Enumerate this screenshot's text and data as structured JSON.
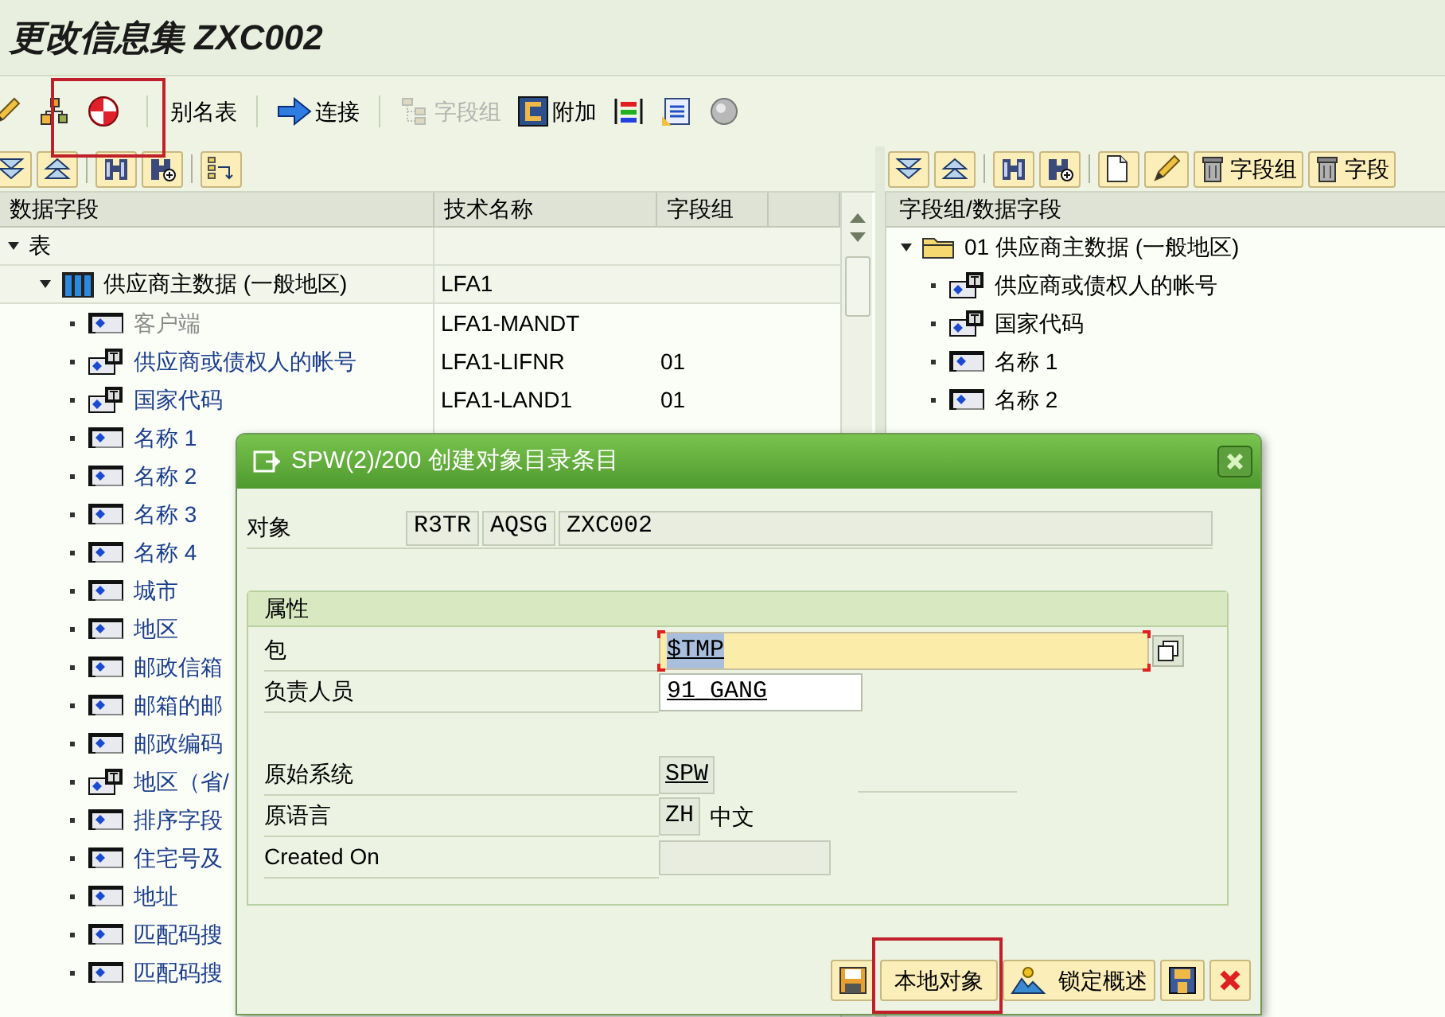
{
  "window": {
    "title": "更改信息集 ZXC002"
  },
  "toolbar": [
    {
      "kind": "icon"
    },
    {
      "kind": "icon"
    },
    {
      "kind": "icon",
      "highlighted": true
    },
    {
      "kind": "separator"
    },
    {
      "kind": "text",
      "label": "别名表",
      "disabled": false
    },
    {
      "kind": "separator"
    },
    {
      "kind": "icon-text",
      "label": "连接",
      "disabled": false
    },
    {
      "kind": "separator"
    },
    {
      "kind": "icon-text",
      "label": "字段组",
      "disabled": true
    },
    {
      "kind": "icon-text",
      "label": "附加",
      "disabled": false
    },
    {
      "kind": "icon"
    },
    {
      "kind": "icon"
    },
    {
      "kind": "icon"
    }
  ],
  "left_pane": {
    "columns": [
      "数据字段",
      "技术名称",
      "字段组"
    ],
    "tree": [
      {
        "label": "表",
        "expanded": true,
        "children": [
          {
            "label": "供应商主数据 (一般地区)",
            "technical_name": "LFA1",
            "kind": "table",
            "expanded": true,
            "children": [
              {
                "label": "客户端",
                "kind": "field",
                "disabled": true,
                "technical_name": "LFA1-MANDT"
              },
              {
                "label": "供应商或债权人的帐号",
                "kind": "text-field",
                "disabled": false,
                "technical_name": "LFA1-LIFNR",
                "field_group": "01"
              },
              {
                "label": "国家代码",
                "kind": "text-field",
                "disabled": false,
                "technical_name": "LFA1-LAND1",
                "field_group": "01"
              },
              {
                "label": "名称 1",
                "kind": "field",
                "disabled": false
              },
              {
                "label": "名称 2",
                "kind": "field",
                "disabled": false
              },
              {
                "label": "名称 3",
                "kind": "field",
                "disabled": false
              },
              {
                "label": "名称 4",
                "kind": "field",
                "disabled": false
              },
              {
                "label": "城市",
                "kind": "field",
                "disabled": false
              },
              {
                "label": "地区",
                "kind": "field",
                "disabled": false
              },
              {
                "label": "邮政信箱",
                "kind": "field",
                "disabled": false
              },
              {
                "label": "邮箱的邮",
                "kind": "field",
                "disabled": false
              },
              {
                "label": "邮政编码",
                "kind": "field",
                "disabled": false
              },
              {
                "label": "地区（省/",
                "kind": "text-field",
                "disabled": false
              },
              {
                "label": "排序字段",
                "kind": "field",
                "disabled": false
              },
              {
                "label": "住宅号及",
                "kind": "field",
                "disabled": false
              },
              {
                "label": "地址",
                "kind": "field",
                "disabled": false
              },
              {
                "label": "匹配码搜",
                "kind": "field",
                "disabled": false
              },
              {
                "label": "匹配码搜",
                "kind": "field",
                "disabled": false
              }
            ]
          }
        ]
      }
    ]
  },
  "right_pane": {
    "toolbar": [
      {
        "kind": "icon"
      },
      {
        "kind": "icon"
      },
      {
        "kind": "icon"
      },
      {
        "kind": "icon"
      },
      {
        "kind": "icon"
      },
      {
        "kind": "icon"
      },
      {
        "kind": "icon-text",
        "label": "字段组"
      },
      {
        "kind": "icon-text",
        "label": "字段"
      }
    ],
    "column": "字段组/数据字段",
    "tree": [
      {
        "label": "01 供应商主数据 (一般地区)",
        "expanded": true,
        "children": [
          {
            "label": "供应商或债权人的帐号",
            "kind": "text-field"
          },
          {
            "label": "国家代码",
            "kind": "text-field"
          },
          {
            "label": "名称 1",
            "kind": "field"
          },
          {
            "label": "名称 2",
            "kind": "field"
          }
        ]
      }
    ]
  },
  "dialog": {
    "title": "SPW(2)/200 创建对象目录条目",
    "object": {
      "label": "对象",
      "values": [
        "R3TR",
        "AQSG",
        "ZXC002"
      ]
    },
    "group": {
      "title": "属性",
      "fields": [
        {
          "label": "包",
          "value": "$TMP",
          "kind": "input",
          "selected": true,
          "required": true
        },
        {
          "label": "负责人员",
          "value": "91_GANG",
          "kind": "input",
          "selected": false,
          "required": false
        },
        {
          "kind": "gap"
        },
        {
          "label": "原始系统",
          "value": "SPW",
          "kind": "readonly"
        },
        {
          "label": "原语言",
          "value": "ZH",
          "description": "中文",
          "kind": "readonly"
        },
        {
          "label": "Created On",
          "kind": "empty"
        }
      ]
    },
    "buttons": [
      {
        "kind": "icon"
      },
      {
        "kind": "text",
        "label": "本地对象",
        "highlighted": true
      },
      {
        "kind": "icon-text",
        "label": "锁定概述"
      },
      {
        "kind": "icon"
      },
      {
        "kind": "icon"
      }
    ]
  }
}
